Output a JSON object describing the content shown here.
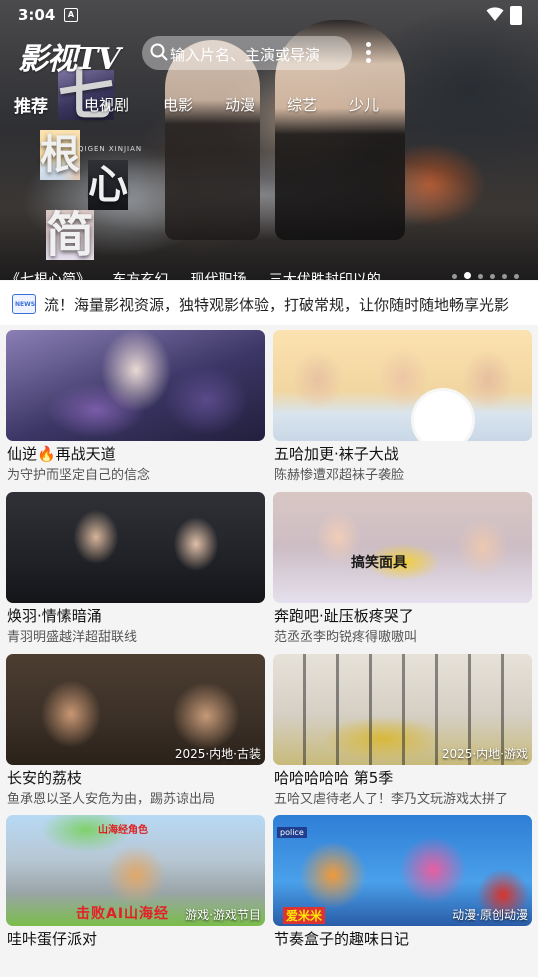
{
  "status_bar": {
    "time": "3:04",
    "badge": "A"
  },
  "header": {
    "logo": "影视TV",
    "search_placeholder": "输入片名、主演或导演"
  },
  "nav_tabs": [
    "推荐",
    "电视剧",
    "电影",
    "动漫",
    "综艺",
    "少儿"
  ],
  "hero": {
    "poster_chars": [
      "七",
      "根",
      "心",
      "简"
    ],
    "poster_sub": "QIGEN XINJIAN",
    "caption": "《七根心简》 ... 东方玄幻 ... 现代职场 ... 三大优胜封印以的"
  },
  "notice": {
    "text": "流！海量影视资源，独特观影体验，打破常规，让你随时随地畅享光影"
  },
  "cards": [
    {
      "title": "仙逆🔥再战天道",
      "desc": "为守护而坚定自己的信念",
      "tag": ""
    },
    {
      "title": "五哈加更·袜子大战",
      "desc": "陈赫惨遭邓超袜子袭脸",
      "tag": ""
    },
    {
      "title": "焕羽·情愫暗涌",
      "desc": "青羽明盛越洋超甜联线",
      "tag": ""
    },
    {
      "title": "奔跑吧·趾压板疼哭了",
      "desc": "范丞丞李昀锐疼得嗷嗷叫",
      "tag": "",
      "overlay": "搞笑面具"
    },
    {
      "title": "长安的荔枝",
      "desc": "鱼承恩以圣人安危为由，踢苏谅出局",
      "tag": "2025·内地·古装"
    },
    {
      "title": "哈哈哈哈哈 第5季",
      "desc": "五哈又虐待老人了！李乃文玩游戏太拼了",
      "tag": "2025·内地·游戏"
    },
    {
      "title": "哇咔蛋仔派对",
      "desc": "",
      "tag": "游戏·游戏节目",
      "overlay_top": "山海经角色",
      "overlay_mid": "击败AI山海经"
    },
    {
      "title": "节奏盒子的趣味日记",
      "desc": "",
      "tag": "动漫·原创动漫",
      "overlay_top": "police",
      "overlay_mid": "爱米米"
    }
  ]
}
